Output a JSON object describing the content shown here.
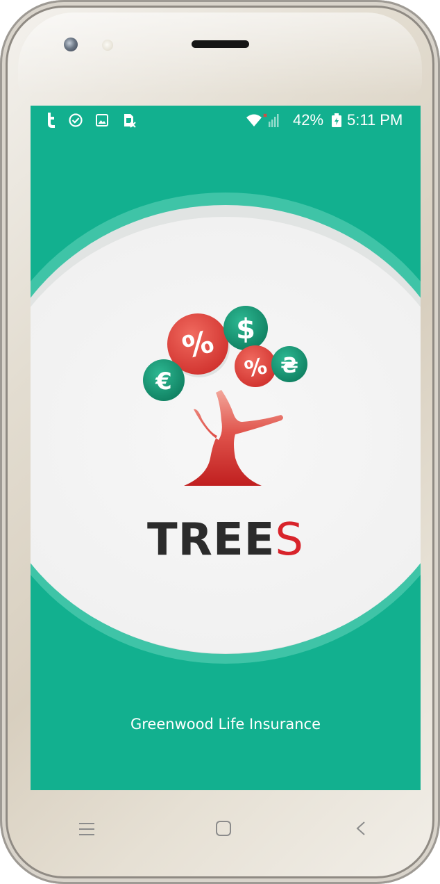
{
  "status_bar": {
    "left_icons": [
      "t-notification-icon",
      "check-circle-icon",
      "image-icon",
      "sim-card-icon"
    ],
    "right_icons": [
      "wifi-icon",
      "signal-icon",
      "battery-icon"
    ],
    "battery_level": "42%",
    "time": "5:11 PM"
  },
  "splash": {
    "brand_main": "TREE",
    "brand_accent": "S",
    "company": "Greenwood Life Insurance",
    "coins": [
      "$",
      "%",
      "%",
      "€",
      "₴"
    ],
    "colors": {
      "background": "#12b08f",
      "ring": "#3fc4a7",
      "disc": "#f2f2f2",
      "coin_red": "#e0453f",
      "coin_green": "#15946f",
      "trunk": "#d8312d",
      "brand_text": "#2b2b2b",
      "brand_accent": "#d8232a"
    }
  },
  "nav_bar": {
    "buttons": [
      "menu-icon",
      "home-icon",
      "back-icon"
    ]
  }
}
